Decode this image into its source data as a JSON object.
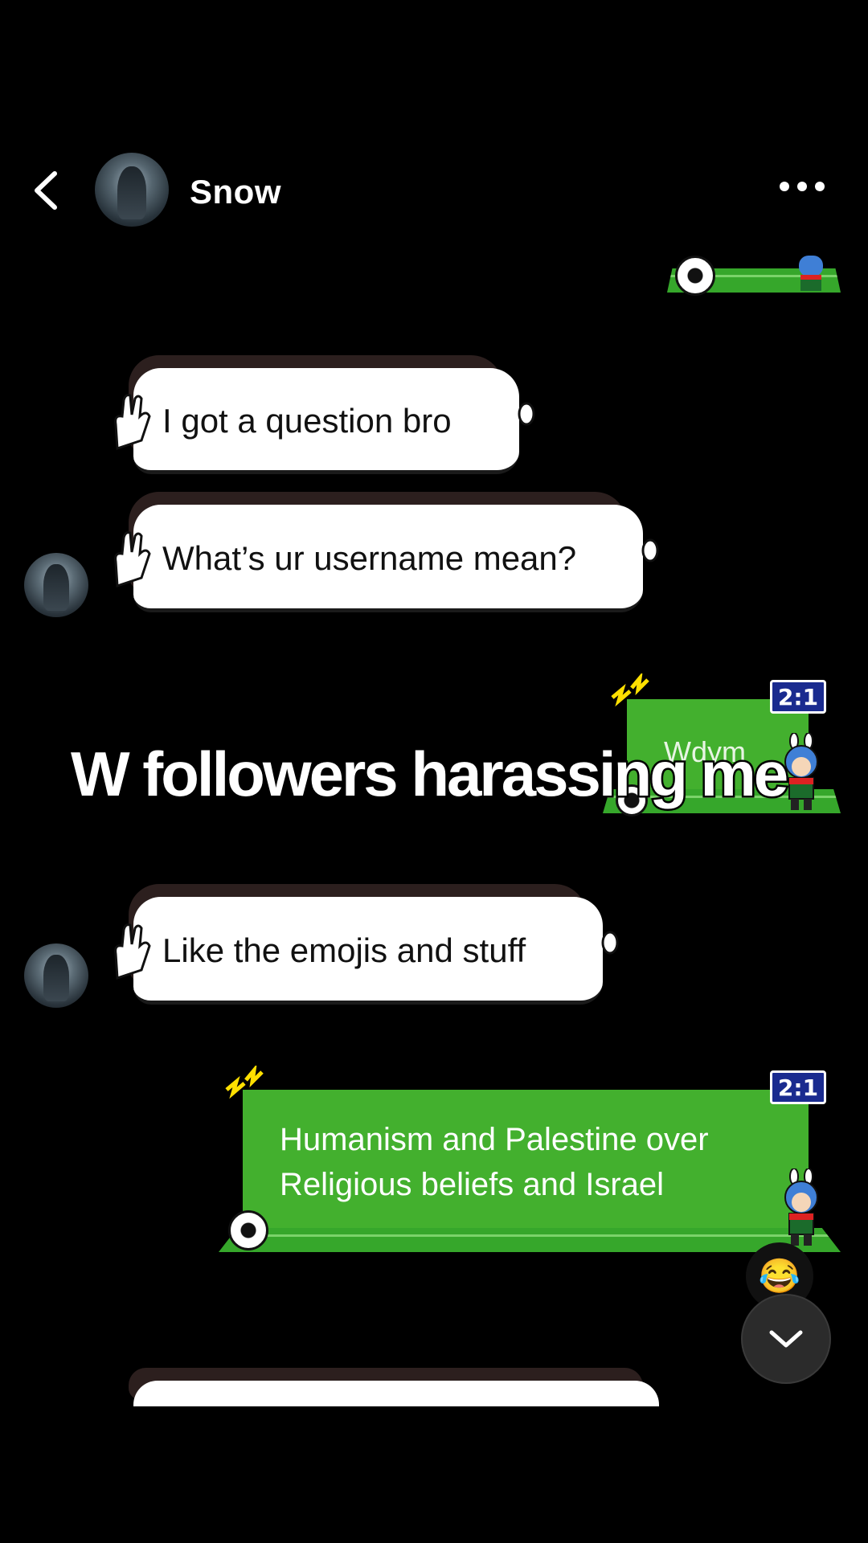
{
  "header": {
    "contact_name": "Snow",
    "back_icon": "chevron-left-icon",
    "more_icon": "more-horizontal-icon"
  },
  "messages": [
    {
      "direction": "incoming",
      "text": "I got a question bro"
    },
    {
      "direction": "incoming",
      "text": "What’s ur username mean?"
    },
    {
      "direction": "outgoing",
      "text": "Wdym"
    },
    {
      "direction": "incoming",
      "text": "Like the emojis and stuff"
    },
    {
      "direction": "outgoing",
      "text": "Humanism and Palestine over Religious beliefs and Israel"
    }
  ],
  "scoreboard": "2:1",
  "reaction": {
    "emoji": "😂"
  },
  "overlay": {
    "caption": "W followers harassing me"
  },
  "colors": {
    "background": "#000000",
    "incoming_bubble": "#ffffff",
    "outgoing_bubble": "#43b02e",
    "scoreboard": "#1a2b8f"
  }
}
